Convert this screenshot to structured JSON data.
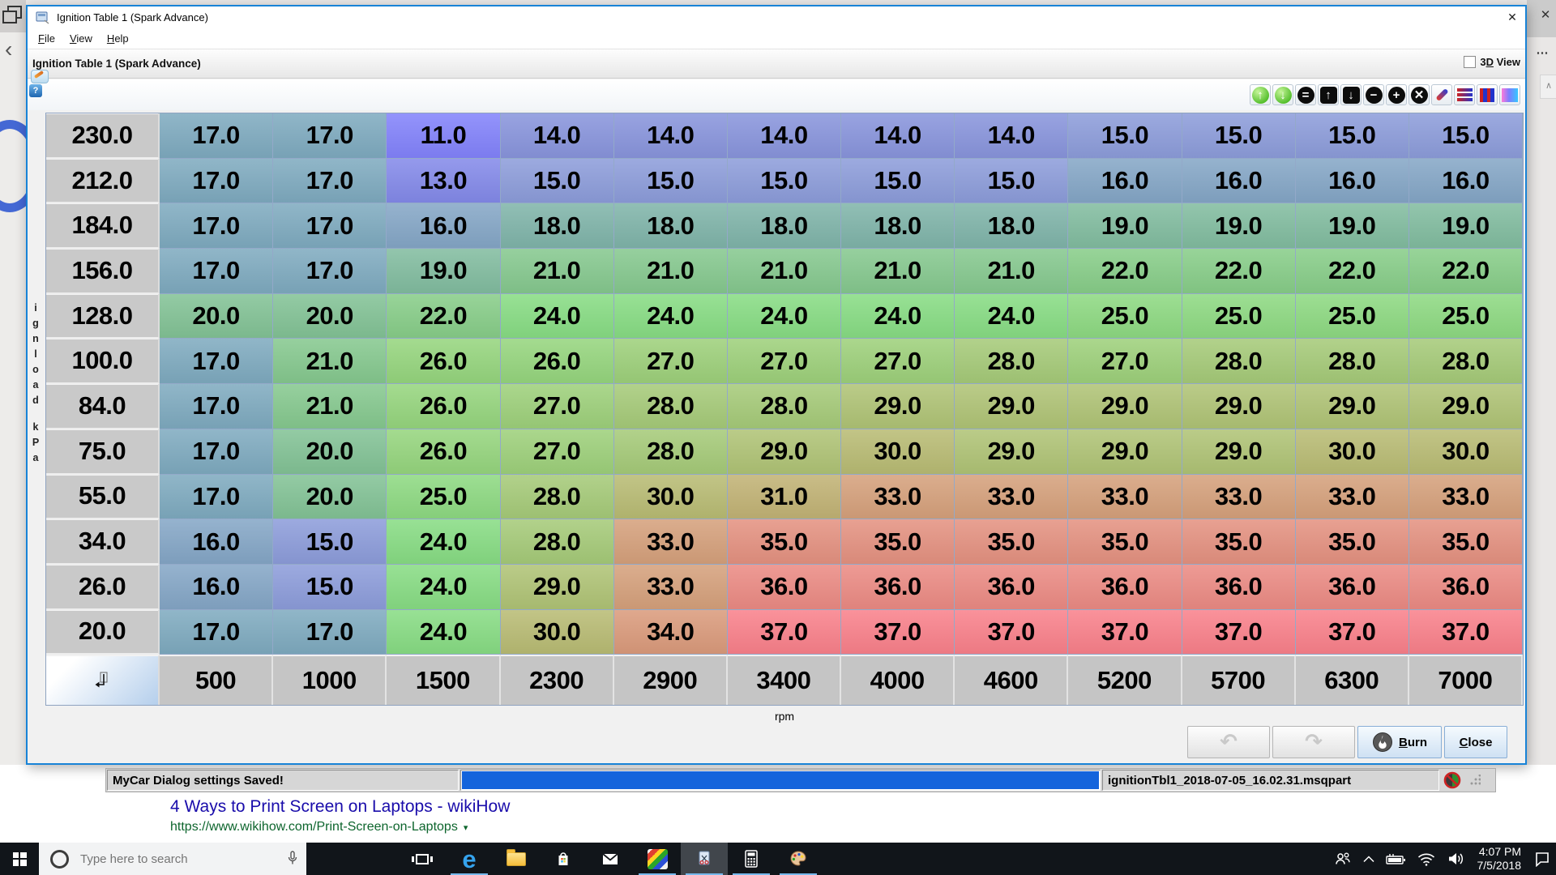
{
  "dialog": {
    "title": "Ignition Table 1 (Spark Advance)",
    "close_glyph": "✕",
    "menu": [
      {
        "label": "File",
        "u": 0
      },
      {
        "label": "View",
        "u": 0
      },
      {
        "label": "Help",
        "u": 0
      }
    ],
    "header_label": "Ignition Table 1 (Spark Advance)",
    "view3d": {
      "label": "3D View",
      "u": 1,
      "checked": false
    },
    "help_glyph": "?",
    "toolbar": [
      {
        "name": "scale-up-icon",
        "kind": "green-up",
        "glyph": "↑"
      },
      {
        "name": "scale-down-icon",
        "kind": "green-down",
        "glyph": "↓"
      },
      {
        "name": "set-equal-icon",
        "kind": "eq",
        "glyph": "="
      },
      {
        "name": "increment-icon",
        "kind": "sq-up",
        "glyph": "↑"
      },
      {
        "name": "decrement-icon",
        "kind": "sq-down",
        "glyph": "↓"
      },
      {
        "name": "minus-icon",
        "kind": "minus",
        "glyph": "−"
      },
      {
        "name": "plus-icon",
        "kind": "plus",
        "glyph": "+"
      },
      {
        "name": "clear-icon",
        "kind": "x",
        "glyph": "✕"
      },
      {
        "name": "edit-pencil-icon",
        "kind": "pencil",
        "glyph": ""
      },
      {
        "name": "interpolate-horizontal-icon",
        "kind": "hbars",
        "glyph": ""
      },
      {
        "name": "interpolate-vertical-icon",
        "kind": "vbars",
        "glyph": ""
      },
      {
        "name": "gradient-swatch-icon",
        "kind": "swatch",
        "glyph": ""
      }
    ],
    "buttons": {
      "undo_glyph": "↶",
      "redo_glyph": "↷",
      "burn": {
        "label": "Burn",
        "u": 0
      },
      "close": {
        "label": "Close",
        "u": 0
      }
    }
  },
  "table": {
    "x_axis_label": "rpm",
    "y_axis_label": "ignload kPa",
    "col_headers": [
      "500",
      "1000",
      "1500",
      "2300",
      "2900",
      "3400",
      "4000",
      "4600",
      "5200",
      "5700",
      "6300",
      "7000"
    ],
    "row_headers": [
      "230.0",
      "212.0",
      "184.0",
      "156.0",
      "128.0",
      "100.0",
      "84.0",
      "75.0",
      "55.0",
      "34.0",
      "26.0",
      "20.0"
    ],
    "values": [
      [
        "17.0",
        "17.0",
        "11.0",
        "14.0",
        "14.0",
        "14.0",
        "14.0",
        "14.0",
        "15.0",
        "15.0",
        "15.0",
        "15.0"
      ],
      [
        "17.0",
        "17.0",
        "13.0",
        "15.0",
        "15.0",
        "15.0",
        "15.0",
        "15.0",
        "16.0",
        "16.0",
        "16.0",
        "16.0"
      ],
      [
        "17.0",
        "17.0",
        "16.0",
        "18.0",
        "18.0",
        "18.0",
        "18.0",
        "18.0",
        "19.0",
        "19.0",
        "19.0",
        "19.0"
      ],
      [
        "17.0",
        "17.0",
        "19.0",
        "21.0",
        "21.0",
        "21.0",
        "21.0",
        "21.0",
        "22.0",
        "22.0",
        "22.0",
        "22.0"
      ],
      [
        "20.0",
        "20.0",
        "22.0",
        "24.0",
        "24.0",
        "24.0",
        "24.0",
        "24.0",
        "25.0",
        "25.0",
        "25.0",
        "25.0"
      ],
      [
        "17.0",
        "21.0",
        "26.0",
        "26.0",
        "27.0",
        "27.0",
        "27.0",
        "28.0",
        "27.0",
        "28.0",
        "28.0",
        "28.0"
      ],
      [
        "17.0",
        "21.0",
        "26.0",
        "27.0",
        "28.0",
        "28.0",
        "29.0",
        "29.0",
        "29.0",
        "29.0",
        "29.0",
        "29.0"
      ],
      [
        "17.0",
        "20.0",
        "26.0",
        "27.0",
        "28.0",
        "29.0",
        "30.0",
        "29.0",
        "29.0",
        "29.0",
        "30.0",
        "30.0"
      ],
      [
        "17.0",
        "20.0",
        "25.0",
        "28.0",
        "30.0",
        "31.0",
        "33.0",
        "33.0",
        "33.0",
        "33.0",
        "33.0",
        "33.0"
      ],
      [
        "16.0",
        "15.0",
        "24.0",
        "28.0",
        "33.0",
        "35.0",
        "35.0",
        "35.0",
        "35.0",
        "35.0",
        "35.0",
        "35.0"
      ],
      [
        "16.0",
        "15.0",
        "24.0",
        "29.0",
        "33.0",
        "36.0",
        "36.0",
        "36.0",
        "36.0",
        "36.0",
        "36.0",
        "36.0"
      ],
      [
        "17.0",
        "17.0",
        "24.0",
        "30.0",
        "34.0",
        "37.0",
        "37.0",
        "37.0",
        "37.0",
        "37.0",
        "37.0",
        "37.0"
      ]
    ],
    "value_colors": {
      "11.0": "#8282fb",
      "13.0": "#8389e9",
      "14.0": "#8894dc",
      "15.0": "#8c9cda",
      "16.0": "#84a6c6",
      "17.0": "#7eaabf",
      "18.0": "#7fb4a9",
      "19.0": "#81bc9f",
      "20.0": "#82c295",
      "21.0": "#85c88e",
      "22.0": "#87cd88",
      "24.0": "#87dc83",
      "25.0": "#8dd981",
      "26.0": "#95d57d",
      "27.0": "#9dd07a",
      "28.0": "#a5ca78",
      "29.0": "#afc375",
      "30.0": "#b8bb73",
      "31.0": "#c1b274",
      "33.0": "#d5a07b",
      "34.0": "#da9a7b",
      "35.0": "#e49180",
      "36.0": "#eb8a83",
      "37.0": "#f9808a"
    }
  },
  "status_bar": {
    "message": "MyCar Dialog settings Saved!",
    "progress_percent": 100,
    "progress_color": "#1464dc",
    "filename": "ignitionTbl1_2018-07-05_16.02.31.msqpart"
  },
  "search_result": {
    "title": "4 Ways to Print Screen on Laptops - wikiHow",
    "url": "https://www.wikihow.com/Print-Screen-on-Laptops",
    "caret_glyph": "▾"
  },
  "background": {
    "underlying_close_glyph": "✕",
    "browser_menu_dots_glyph": "⋯",
    "scroll_up_glyph": "∧",
    "back_chevron_glyph": "‹"
  },
  "taskbar": {
    "search_placeholder": "Type here to search",
    "apps": [
      {
        "name": "task-view-icon",
        "kind": "taskview",
        "running": false,
        "active": false
      },
      {
        "name": "edge-icon",
        "kind": "edge",
        "running": true,
        "active": false
      },
      {
        "name": "file-explorer-icon",
        "kind": "explorer",
        "running": false,
        "active": false
      },
      {
        "name": "store-icon",
        "kind": "store",
        "running": false,
        "active": false
      },
      {
        "name": "mail-icon",
        "kind": "mail",
        "running": false,
        "active": false
      },
      {
        "name": "tunerstudio-icon",
        "kind": "tunerstudio",
        "running": true,
        "active": false
      },
      {
        "name": "snipping-tool-icon",
        "kind": "snip",
        "running": true,
        "active": true
      },
      {
        "name": "calculator-icon",
        "kind": "calc",
        "running": true,
        "active": false
      },
      {
        "name": "paint-icon",
        "kind": "paint",
        "running": true,
        "active": false
      }
    ],
    "clock": {
      "time": "4:07 PM",
      "date": "7/5/2018"
    }
  }
}
